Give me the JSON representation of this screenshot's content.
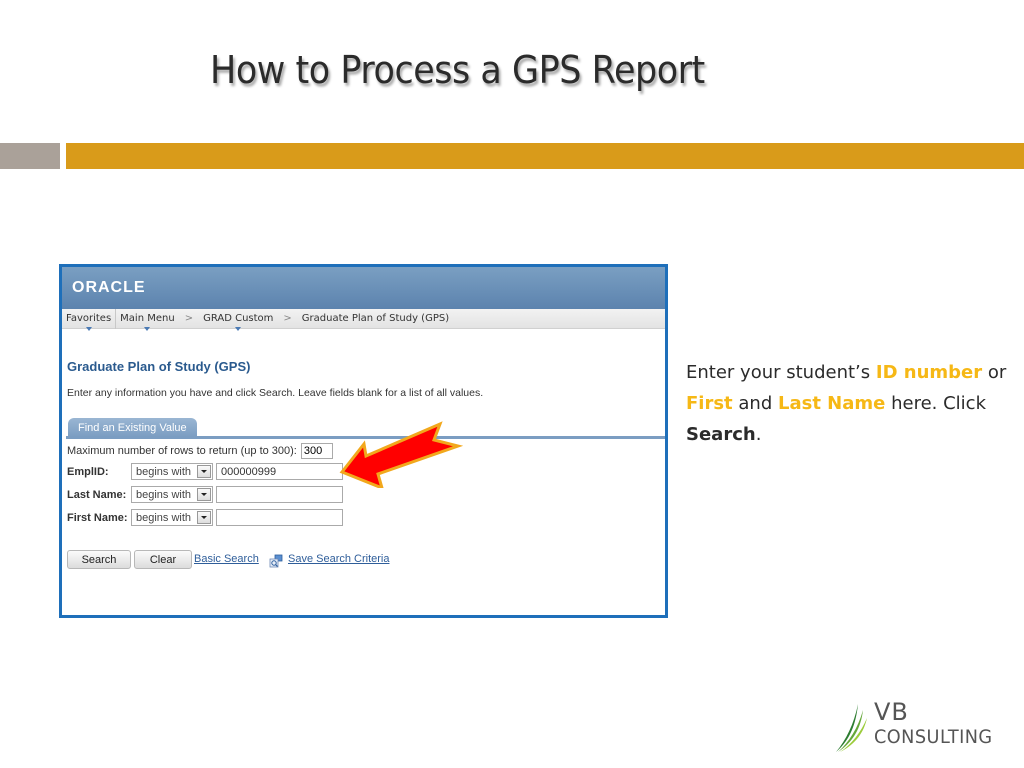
{
  "slide": {
    "title": "How to Process a GPS Report",
    "colors": {
      "accent_bar": "#d99b1a",
      "side_bar": "#aaa199",
      "highlight": "#f6b816",
      "frame": "#1e6fba"
    }
  },
  "screenshot": {
    "brand": "ORACLE",
    "nav": {
      "items": [
        {
          "label": "Favorites"
        },
        {
          "label": "Main Menu"
        },
        {
          "label": "GRAD Custom"
        },
        {
          "label": "Graduate Plan of Study (GPS)"
        }
      ],
      "separator": ">"
    },
    "page_title": "Graduate Plan of Study (GPS)",
    "instructions": "Enter any information you have and click Search. Leave fields blank for a list of all values.",
    "tab_label": "Find an Existing Value",
    "max_rows": {
      "label": "Maximum number of rows to return (up to 300):",
      "value": "300"
    },
    "fields": [
      {
        "label": "EmplID:",
        "operator": "begins with",
        "value": "000000999"
      },
      {
        "label": "Last Name:",
        "operator": "begins with",
        "value": ""
      },
      {
        "label": "First Name:",
        "operator": "begins with",
        "value": ""
      }
    ],
    "buttons": {
      "search": "Search",
      "clear": "Clear"
    },
    "links": {
      "basic_search": "Basic Search",
      "save_criteria": "Save Search Criteria"
    }
  },
  "callout": {
    "part1": "Enter your student’s ",
    "id_number": "ID number",
    "part2": " or ",
    "first": "First",
    "part3": " and ",
    "last_name": "Last Name",
    "part4": " here. Click ",
    "search": "Search",
    "part5": "."
  },
  "logo": {
    "line1": "VB",
    "line2": "CONSULTING"
  }
}
